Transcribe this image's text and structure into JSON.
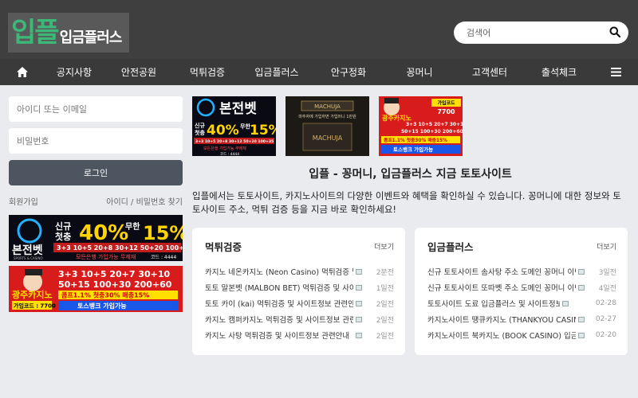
{
  "header": {
    "logo_big": "입플",
    "logo_small": "입금플러스",
    "search_placeholder": "검색어"
  },
  "nav": {
    "items": [
      "공지사항",
      "안전공원",
      "먹튀검증",
      "입금플러스",
      "안구정화",
      "꽁머니",
      "고객센터",
      "출석체크"
    ]
  },
  "login": {
    "id_placeholder": "아이디 또는 이메일",
    "pw_placeholder": "비밀번호",
    "button": "로그인",
    "signup": "회원가입",
    "find": "아이디 / 비밀번호 찾기"
  },
  "banners": {
    "bonjeon": {
      "brand": "본전벳",
      "sub": "SPORTS & CASINO",
      "promo_a": "신규",
      "promo_b": "첫충",
      "percent": "40%",
      "unlimited": "무한",
      "percent2": "15%",
      "line": "3+3 10+5 20+8 30+12 50+20 100+35",
      "small": "모든은행 가입가능 무제재",
      "code": "코드 : 4444"
    },
    "machuja": {
      "brand": "MACHUJA",
      "tagline": "마추자에 가입하면 가입머니 1만원",
      "label": "MACHUJA"
    },
    "gwangju": {
      "brand": "광주카지노",
      "code_label": "가입코드",
      "code": "7700",
      "line1": "3+3 10+5 20+7 30+10",
      "line2": "50+15 100+30 200+60",
      "line3": "콤프1.1% 첫충30% 매충15%",
      "line4": "토스뱅크 가입가능",
      "code_full": "가입코드 : 7700"
    }
  },
  "headline": "입플 - 꽁머니, 입금플러스 지금 토토사이트",
  "description": "입플에서는 토토사이트, 카지노사이트의 다양한 이벤트와 혜택을 확인하실 수 있습니다. 꽁머니에 대한 정보와 토토사이트 주소, 먹튀 검증 등을 지금 바로 확인하세요!",
  "cards": [
    {
      "title": "먹튀검증",
      "more": "더보기",
      "rows": [
        {
          "title": "카지노 네온카지노 (Neon Casino) 먹튀검증 및",
          "date": "2분전"
        },
        {
          "title": "토토 말본벳 (MALBON BET) 먹튀검증 및 사이",
          "date": "1일전"
        },
        {
          "title": "토토 카이 (kai) 먹튀검증 및 사이트정보 관련안내",
          "date": "2일전"
        },
        {
          "title": "카지노 캠퍼카지노 먹튀검증 및 사이트정보 관련",
          "date": "2일전"
        },
        {
          "title": "카지노 사탕 먹튀검증 및 사이트정보 관련안내",
          "date": "2일전"
        }
      ]
    },
    {
      "title": "입금플러스",
      "more": "더보기",
      "rows": [
        {
          "title": "신규 토토사이트 솜사탕 주소 도메인 꽁머니 이벤",
          "date": "3일전"
        },
        {
          "title": "신규 토토사이트 또따벳 주소 도메인 꽁머니 이벤",
          "date": "4일전"
        },
        {
          "title": "토토사이트 도료 입금플러스 및 사이트정보",
          "date": "02-28"
        },
        {
          "title": "카지노사이트 땡큐카지노 (THANKYOU CASIN",
          "date": "02-27"
        },
        {
          "title": "카지노사이트 북카지노 (BOOK CASINO) 입금",
          "date": "02-20"
        }
      ]
    }
  ]
}
